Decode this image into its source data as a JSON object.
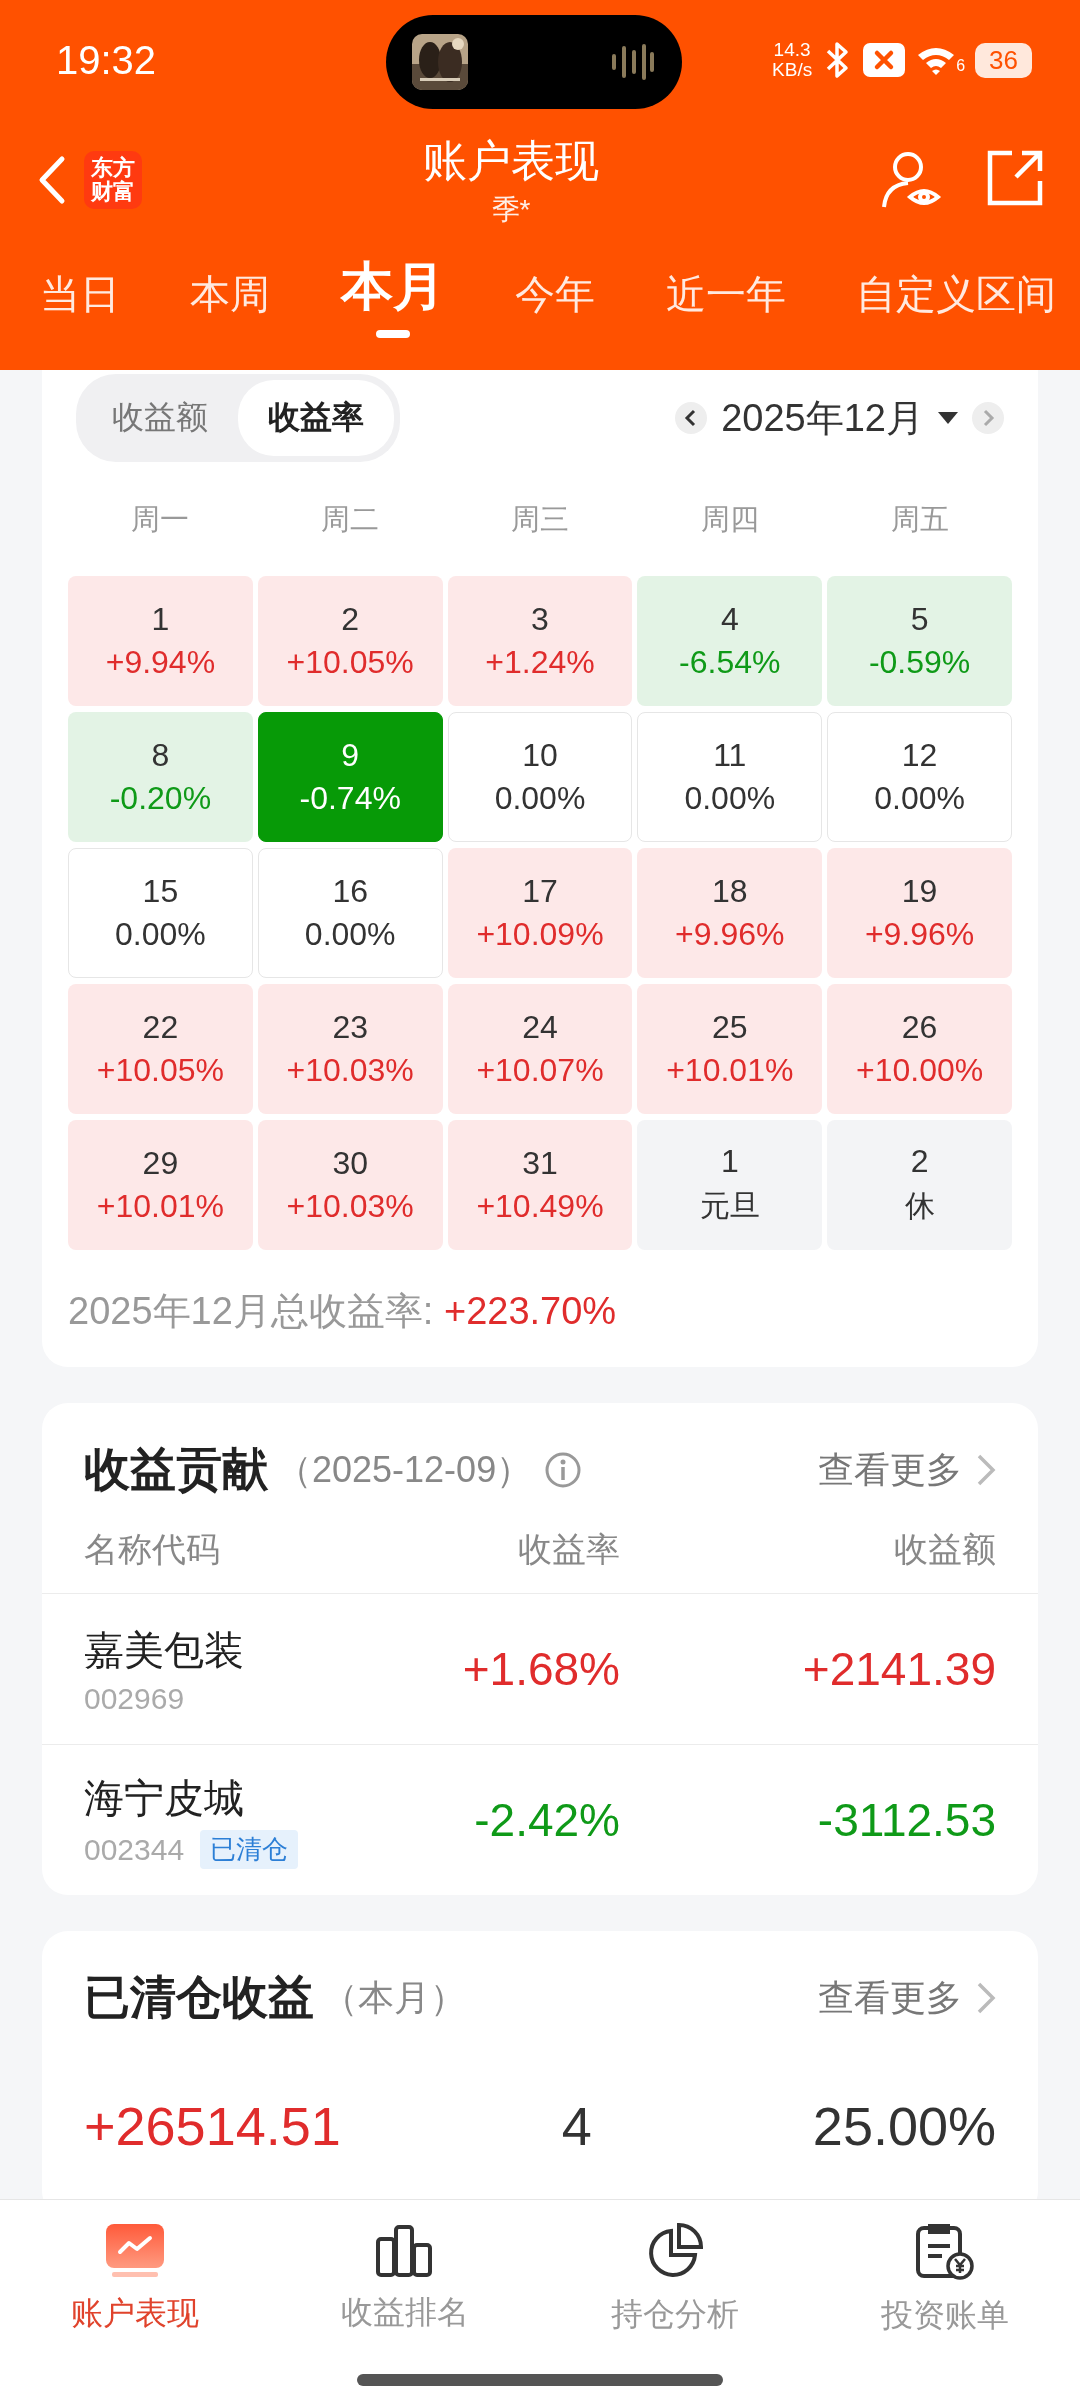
{
  "status": {
    "time": "19:32",
    "speed_value": "14.3",
    "speed_unit": "KB/s",
    "wifi_label": "6",
    "battery": "36"
  },
  "header": {
    "logo": [
      "东方",
      "财富"
    ],
    "title": "账户表现",
    "subtitle": "季*"
  },
  "period_tabs": [
    {
      "label": "当日",
      "selected": false
    },
    {
      "label": "本周",
      "selected": false
    },
    {
      "label": "本月",
      "selected": true
    },
    {
      "label": "今年",
      "selected": false
    },
    {
      "label": "近一年",
      "selected": false
    },
    {
      "label": "自定义区间",
      "selected": false
    }
  ],
  "calendar": {
    "toggle": [
      {
        "label": "收益额",
        "selected": false
      },
      {
        "label": "收益率",
        "selected": true
      }
    ],
    "month": "2025年12月",
    "weekdays": [
      "周一",
      "周二",
      "周三",
      "周四",
      "周五"
    ],
    "days": [
      {
        "day": "1",
        "value": "+9.94%",
        "kind": "up",
        "selected": false
      },
      {
        "day": "2",
        "value": "+10.05%",
        "kind": "up",
        "selected": false
      },
      {
        "day": "3",
        "value": "+1.24%",
        "kind": "up",
        "selected": false
      },
      {
        "day": "4",
        "value": "-6.54%",
        "kind": "down",
        "selected": false
      },
      {
        "day": "5",
        "value": "-0.59%",
        "kind": "down",
        "selected": false
      },
      {
        "day": "8",
        "value": "-0.20%",
        "kind": "down",
        "selected": false
      },
      {
        "day": "9",
        "value": "-0.74%",
        "kind": "down",
        "selected": true
      },
      {
        "day": "10",
        "value": "0.00%",
        "kind": "flat",
        "selected": false
      },
      {
        "day": "11",
        "value": "0.00%",
        "kind": "flat",
        "selected": false
      },
      {
        "day": "12",
        "value": "0.00%",
        "kind": "flat",
        "selected": false
      },
      {
        "day": "15",
        "value": "0.00%",
        "kind": "flat",
        "selected": false
      },
      {
        "day": "16",
        "value": "0.00%",
        "kind": "flat",
        "selected": false
      },
      {
        "day": "17",
        "value": "+10.09%",
        "kind": "up",
        "selected": false
      },
      {
        "day": "18",
        "value": "+9.96%",
        "kind": "up",
        "selected": false
      },
      {
        "day": "19",
        "value": "+9.96%",
        "kind": "up",
        "selected": false
      },
      {
        "day": "22",
        "value": "+10.05%",
        "kind": "up",
        "selected": false
      },
      {
        "day": "23",
        "value": "+10.03%",
        "kind": "up",
        "selected": false
      },
      {
        "day": "24",
        "value": "+10.07%",
        "kind": "up",
        "selected": false
      },
      {
        "day": "25",
        "value": "+10.01%",
        "kind": "up",
        "selected": false
      },
      {
        "day": "26",
        "value": "+10.00%",
        "kind": "up",
        "selected": false
      },
      {
        "day": "29",
        "value": "+10.01%",
        "kind": "up",
        "selected": false
      },
      {
        "day": "30",
        "value": "+10.03%",
        "kind": "up",
        "selected": false
      },
      {
        "day": "31",
        "value": "+10.49%",
        "kind": "up",
        "selected": false
      },
      {
        "day": "1",
        "value": "元旦",
        "kind": "holiday",
        "selected": false
      },
      {
        "day": "2",
        "value": "休",
        "kind": "holiday",
        "selected": false
      }
    ],
    "total_label": "2025年12月总收益率:",
    "total_value": "+223.70%"
  },
  "contribution": {
    "title": "收益贡献",
    "date": "（2025-12-09）",
    "more": "查看更多",
    "columns": [
      "名称代码",
      "收益率",
      "收益额"
    ],
    "rows": [
      {
        "name": "嘉美包装",
        "code": "002969",
        "rate": "+1.68%",
        "amount": "+2141.39",
        "kind": "up"
      },
      {
        "name": "海宁皮城",
        "code": "002344",
        "tag": "已清仓",
        "rate": "-2.42%",
        "amount": "-3112.53",
        "kind": "down"
      }
    ]
  },
  "cleared": {
    "title": "已清仓收益",
    "period": "（本月）",
    "more": "查看更多",
    "stats": [
      {
        "value": "+26514.51",
        "kind": "up"
      },
      {
        "value": "4",
        "kind": "neutral"
      },
      {
        "value": "25.00%",
        "kind": "neutral"
      }
    ]
  },
  "bottom_tabs": [
    {
      "label": "账户表现",
      "selected": true
    },
    {
      "label": "收益排名",
      "selected": false
    },
    {
      "label": "持仓分析",
      "selected": false
    },
    {
      "label": "投资账单",
      "selected": false
    }
  ]
}
